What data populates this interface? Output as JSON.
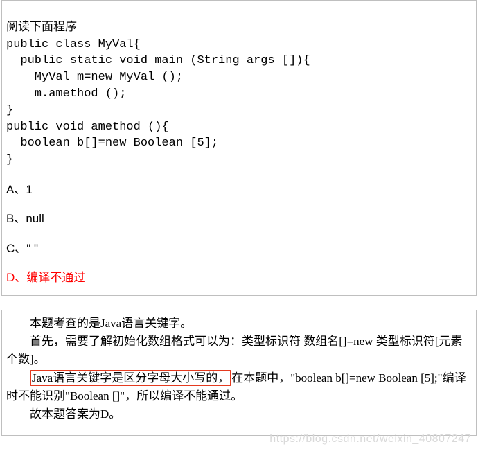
{
  "question": {
    "intro": "阅读下面程序",
    "code_lines": [
      "public class MyVal{",
      "  public static void main (String args []){",
      "    MyVal m=new MyVal ();",
      "    m.amethod ();",
      "}",
      "public void amethod (){",
      "  boolean b[]=new Boolean [5];",
      "}"
    ]
  },
  "options": {
    "a": "A、1",
    "b": "B、null",
    "c": "C、\" \"",
    "d": "D、编译不通过"
  },
  "explanation": {
    "p1": "本题考查的是Java语言关键字。",
    "p2": "首先，需要了解初始化数组格式可以为：类型标识符 数组名[]=new 类型标识符[元素个数]。",
    "p3_hl": "Java语言关键字是区分字母大小写的，",
    "p3_rest": "在本题中，\"boolean b[]=new Boolean [5];\"编译时不能识别\"Boolean []\"，所以编译不能通过。",
    "p4": "故本题答案为D。"
  },
  "watermark": "https://blog.csdn.net/weixin_40807247"
}
